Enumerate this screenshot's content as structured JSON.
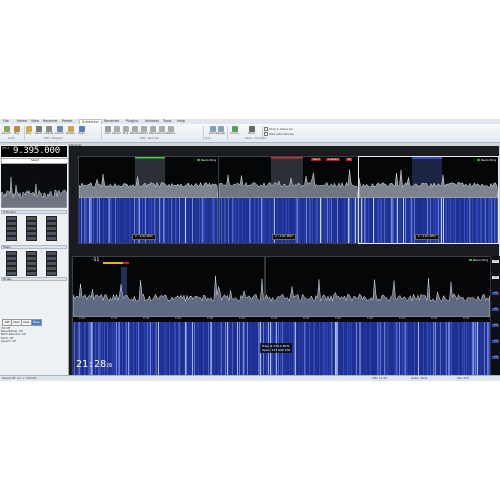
{
  "ribbon": {
    "tabs": [
      "File",
      "Home",
      "View",
      "Receiver",
      "Preset",
      "Scheduler",
      "Recorder",
      "Plugins",
      "Network",
      "Tools",
      "Help"
    ],
    "active_tab": "Receiver",
    "buttons": [
      {
        "label": "Record",
        "icon": "record-icon",
        "color": "#8da35b"
      },
      {
        "label": "Play",
        "icon": "play-icon",
        "color": "#b68a4a"
      },
      {
        "label": "Stop",
        "icon": "stop-icon",
        "color": "#d6a83b"
      },
      {
        "label": "Pause",
        "icon": "pause-icon",
        "color": "#777"
      },
      {
        "label": "Calibrate",
        "icon": "calibrate-icon",
        "color": "#8a8a8a"
      },
      {
        "label": "Load Preset",
        "icon": "load-icon",
        "color": "#6b88b4"
      },
      {
        "label": "Browse",
        "icon": "browse-icon",
        "color": "#c9a83f"
      },
      {
        "label": "Open",
        "icon": "open-icon",
        "color": "#5d7fb0"
      },
      {
        "label": "Scan",
        "icon": "scan-icon",
        "color": "#999"
      },
      {
        "label": "Record",
        "icon": "record-icon",
        "color": "#aaa"
      },
      {
        "label": "Stop",
        "icon": "stop-icon",
        "color": "#aaa"
      },
      {
        "label": "Resume",
        "icon": "resume-icon",
        "color": "#aaa"
      },
      {
        "label": "Restart",
        "icon": "restart-icon",
        "color": "#aaa"
      },
      {
        "label": "Reset",
        "icon": "reset-icon",
        "color": "#aaa"
      },
      {
        "label": "Reconnect",
        "icon": "reconnect-icon",
        "color": "#aaa"
      },
      {
        "label": "Restore",
        "icon": "restore-icon",
        "color": "#aaa"
      },
      {
        "label": "Zoom",
        "icon": "zoom-icon",
        "color": "#7ea0c8"
      },
      {
        "label": "Navigator",
        "icon": "navigator-icon",
        "color": "#8aa0b8"
      },
      {
        "label": "Connector",
        "icon": "connector-icon",
        "color": "#5b9a5b"
      },
      {
        "label": "Radio",
        "icon": "radio-icon",
        "color": "#666"
      }
    ],
    "groups": [
      "Audio",
      "Data - Playback",
      "Data - Recorder",
      "Tools",
      "Radio - Connector"
    ],
    "checks": [
      "Show in status bar",
      "Start automatically"
    ]
  },
  "left": {
    "freq_prefix": "VFO A",
    "frequency": "9.395.000",
    "mode_select": "Select",
    "section_titles": [
      "IF Monitor",
      "Filters",
      "Modes"
    ],
    "tabs": [
      "Diff",
      "Peak",
      "Peak",
      "Mean"
    ],
    "active_tab_index": 3,
    "log_lines": [
      "CW: Off",
      "Noise Blanker: Off",
      "Notch Reduction: Off",
      "Notch: Off",
      "Squelch: Off"
    ]
  },
  "main": {
    "window_title": "Windows",
    "recording_label": "Recording",
    "panels": [
      {
        "span": "2 : 4.82 MHz"
      },
      {
        "span": "2 : 4.81 MHz",
        "bar_buttons": [
          "Select",
          "Available",
          "OK"
        ]
      },
      {
        "span": "2 : 4.81 MHz"
      }
    ],
    "big": {
      "level": "-51",
      "freq_label": "Freq: 9.476.0 MHz",
      "span_label": "Span: 143.600 kHz",
      "clock": "21:28",
      "clock_seconds": "28",
      "x_ticks": [
        "9.300",
        "9.320",
        "9.340",
        "9.360",
        "9.380",
        "9.400",
        "9.420",
        "9.440",
        "9.460",
        "9.480",
        "9.500",
        "9.520",
        "9.540"
      ]
    },
    "right_scale": [
      "-20",
      "-40",
      "-60",
      "-80",
      "-100",
      "-120",
      "-140"
    ]
  },
  "status": {
    "left": "Stream RF: 9.5 + 7.93 kHz",
    "right1": "CPU: 12.4%",
    "right2": "Audio: 23ms",
    "right3": "Idle: 27%"
  }
}
